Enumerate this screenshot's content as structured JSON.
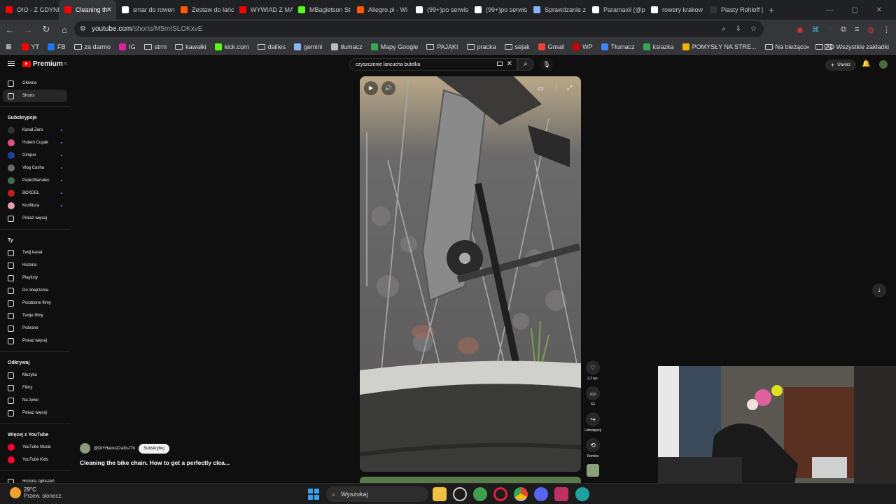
{
  "tabs": [
    {
      "label": "OIO - Z GDYNI",
      "color": "#ff0000"
    },
    {
      "label": "Cleaning th",
      "color": "#ff0000",
      "active": true
    },
    {
      "label": "smar do rowen",
      "color": "#ffffff"
    },
    {
      "label": "Zestaw do łańc",
      "color": "#ff5a00"
    },
    {
      "label": "WYWIAD Z MA",
      "color": "#ff0000"
    },
    {
      "label": "MBagietson St",
      "color": "#53fc18"
    },
    {
      "label": "Allegro.pl - Wi",
      "color": "#ff5a00"
    },
    {
      "label": "(99+)po serwis",
      "color": "#ffffff"
    },
    {
      "label": "(99+)po serwis",
      "color": "#ffffff"
    },
    {
      "label": "Sprawdzanie z",
      "color": "#8ab4f8"
    },
    {
      "label": "Paramaxil (@p",
      "color": "#ffffff"
    },
    {
      "label": "rowery krakow",
      "color": "#ffffff"
    },
    {
      "label": "Piasty Rohloff |",
      "color": "#333333"
    }
  ],
  "omnibox": {
    "host": "youtube.com",
    "path": "/shorts/M5mISLOKxvE"
  },
  "bookmarks": [
    {
      "label": "YT",
      "type": "icon",
      "color": "#ff0000"
    },
    {
      "label": "FB",
      "type": "icon",
      "color": "#1877f2"
    },
    {
      "label": "za darmo",
      "type": "folder"
    },
    {
      "label": "IG",
      "type": "icon",
      "color": "#d6249f"
    },
    {
      "label": "strm",
      "type": "folder"
    },
    {
      "label": "kawałki",
      "type": "folder"
    },
    {
      "label": "kick.com",
      "type": "icon",
      "color": "#53fc18"
    },
    {
      "label": "dailies",
      "type": "folder"
    },
    {
      "label": "gemini",
      "type": "icon",
      "color": "#8ab4f8"
    },
    {
      "label": "tłumacz",
      "type": "icon",
      "color": "#bbbbbb"
    },
    {
      "label": "Mapy Google",
      "type": "icon",
      "color": "#34a853"
    },
    {
      "label": "PAJĄKI",
      "type": "folder"
    },
    {
      "label": "pracka",
      "type": "folder"
    },
    {
      "label": "sejak",
      "type": "folder"
    },
    {
      "label": "Gmail",
      "type": "icon",
      "color": "#ea4335"
    },
    {
      "label": "WP",
      "type": "icon",
      "color": "#d00000"
    },
    {
      "label": "Tłumacz",
      "type": "icon",
      "color": "#4285f4"
    },
    {
      "label": "ksiazka",
      "type": "icon",
      "color": "#34a853"
    },
    {
      "label": "POMYSŁY NA STRE...",
      "type": "icon",
      "color": "#f4b400"
    },
    {
      "label": "Na bieżąco",
      "type": "folder"
    },
    {
      "label": "AD",
      "type": "folder"
    }
  ],
  "bookmarks_all": "Wszystkie zakładki",
  "yt": {
    "logo": "Premium",
    "logo_sup": "PL",
    "search_value": "czyszczenie lancucha butelka",
    "create_label": "Utwórz"
  },
  "sidebar": {
    "main": [
      {
        "label": "Główna"
      },
      {
        "label": "Shorts",
        "active": true
      }
    ],
    "subs_head": "Subskrypcje",
    "subs": [
      {
        "label": "Kanał Zero",
        "color": "#333333"
      },
      {
        "label": "Hubert Cupak",
        "color": "#e05080"
      },
      {
        "label": "Gimper",
        "color": "#2040a0"
      },
      {
        "label": "Vlog Casha",
        "color": "#6a6a6a"
      },
      {
        "label": "PatecWariatec",
        "color": "#407050"
      },
      {
        "label": "BOXDEL",
        "color": "#c02020"
      },
      {
        "label": "Konfitura",
        "color": "#e0a0b0"
      }
    ],
    "subs_more": "Pokaż więcej",
    "you_head": "Ty",
    "you": [
      {
        "label": "Twój kanał"
      },
      {
        "label": "Historia"
      },
      {
        "label": "Playlisty"
      },
      {
        "label": "Do obejrzenia"
      },
      {
        "label": "Polubione filmy"
      },
      {
        "label": "Twoje filmy"
      },
      {
        "label": "Pobrane"
      },
      {
        "label": "Pokaż więcej"
      }
    ],
    "explore_head": "Odkrywaj",
    "explore": [
      {
        "label": "Muzyka"
      },
      {
        "label": "Filmy"
      },
      {
        "label": "Na żywo"
      },
      {
        "label": "Pokaż więcej"
      }
    ],
    "more_head": "Więcej z YouTube",
    "more": [
      {
        "label": "YouTube Music"
      },
      {
        "label": "YouTube Kids"
      }
    ],
    "report": "Historia zgłoszeń"
  },
  "short": {
    "channel": "@DIYHacksCrafts-f7n",
    "subscribe": "Subskrybuj",
    "title": "Cleaning the bike chain. How to get a perfectly clea...",
    "likes": "2,2 tys.",
    "comments": "63",
    "share": "Udostępnij",
    "remix": "Remiks"
  },
  "taskbar": {
    "temp": "29°C",
    "weather": "Przew. słonecz.",
    "search": "Wyszukaj"
  }
}
